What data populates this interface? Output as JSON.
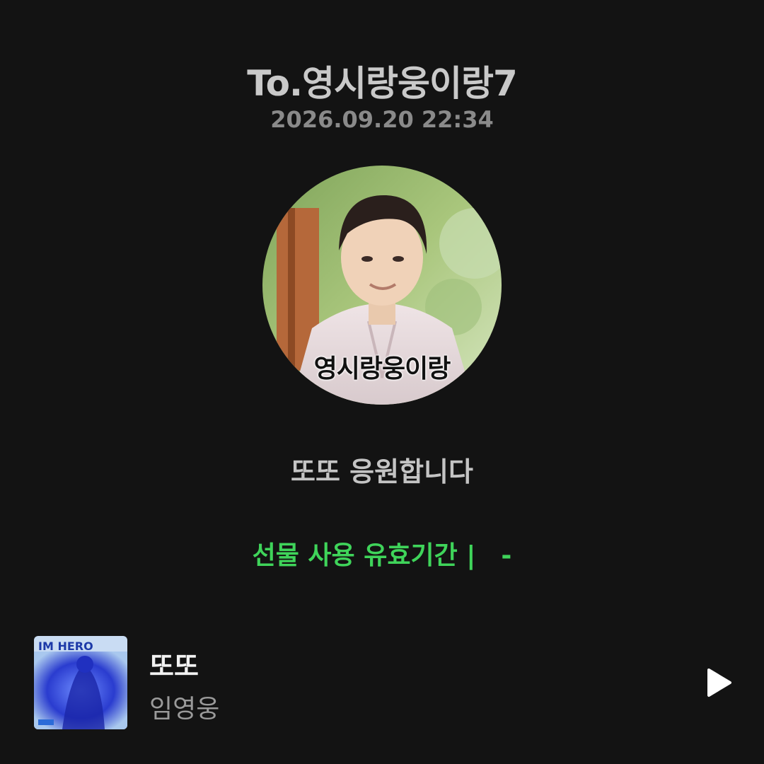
{
  "header": {
    "recipient": "To.영시랑웅이랑7",
    "timestamp": "2026.09.20 22:34"
  },
  "profile": {
    "caption": "영시랑웅이랑"
  },
  "message": "또또 응원합니다",
  "gift": {
    "validity_label": "선물 사용 유효기간 |",
    "validity_value": "-"
  },
  "track": {
    "title": "또또",
    "artist": "임영웅",
    "cover_text": "IM HERO",
    "play_icon": "play-icon"
  },
  "colors": {
    "background": "#131313",
    "accent_green": "#3fd45a"
  }
}
